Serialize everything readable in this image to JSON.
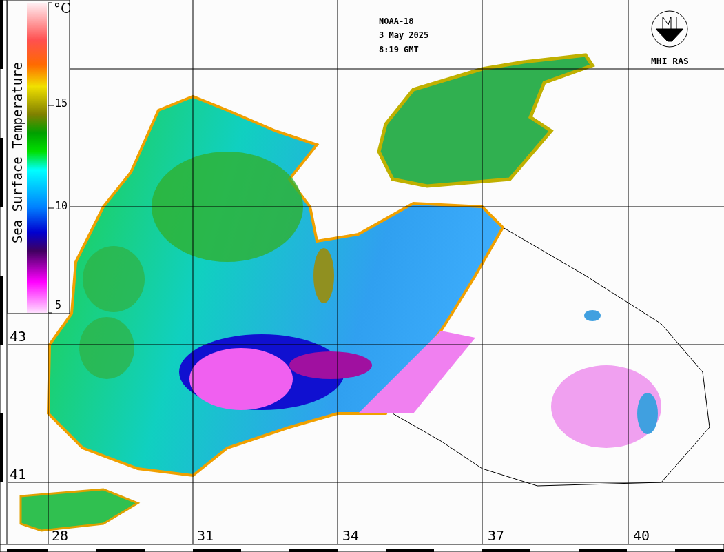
{
  "header": {
    "satellite": "NOAA-18",
    "date": "3 May 2025",
    "time": "8:19 GMT"
  },
  "logo": {
    "text": "MHI RAS"
  },
  "legend": {
    "title": "Sea Surface Temperature",
    "unit": "°C",
    "ticks": [
      "15",
      "10",
      "5"
    ]
  },
  "latitude_labels": [
    "43",
    "41"
  ],
  "longitude_labels": [
    "28",
    "31",
    "34",
    "37",
    "40"
  ]
}
